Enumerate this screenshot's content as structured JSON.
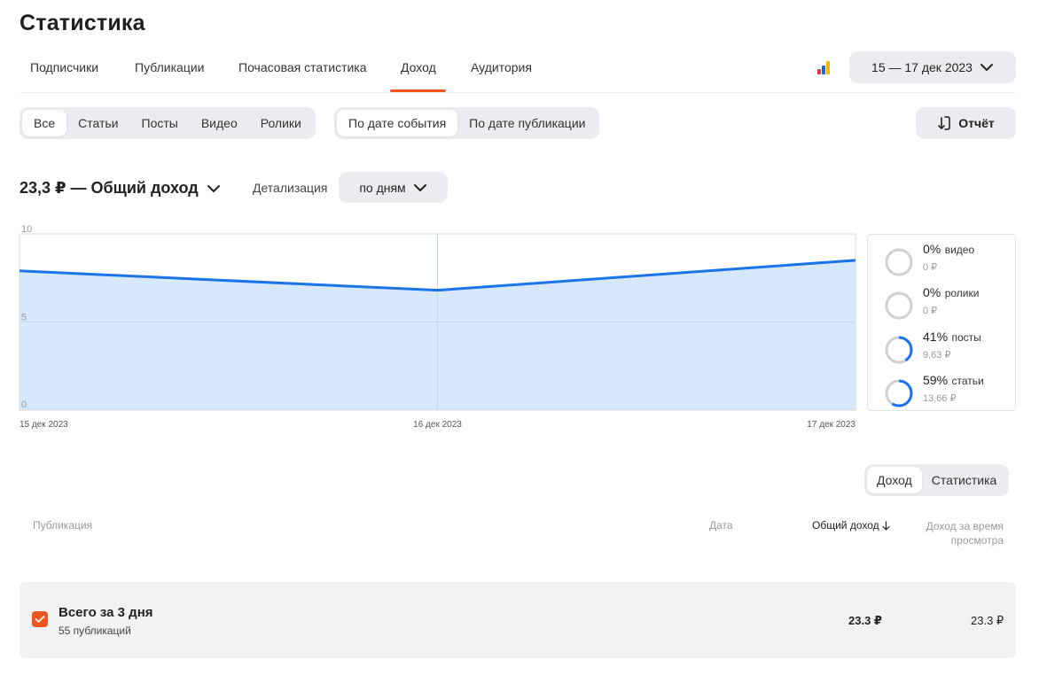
{
  "page_title": "Статистика",
  "nav_tabs": [
    {
      "label": "Подписчики",
      "active": false
    },
    {
      "label": "Публикации",
      "active": false
    },
    {
      "label": "Почасовая статистика",
      "active": false
    },
    {
      "label": "Доход",
      "active": true
    },
    {
      "label": "Аудитория",
      "active": false
    }
  ],
  "date_range": "15 — 17 дек 2023",
  "content_filter": [
    "Все",
    "Статьи",
    "Посты",
    "Видео",
    "Ролики"
  ],
  "content_filter_active": "Все",
  "date_mode": [
    "По дате события",
    "По дате публикации"
  ],
  "date_mode_active": "По дате события",
  "report_label": "Отчёт",
  "summary": {
    "total_label": "23,3 ₽ — Общий доход",
    "detail_label": "Детализация",
    "detail_value": "по дням"
  },
  "chart_data": {
    "type": "area",
    "x": [
      "15 дек 2023",
      "16 дек 2023",
      "17 дек 2023"
    ],
    "series": [
      {
        "values": [
          7.9,
          6.8,
          8.5
        ]
      }
    ],
    "ylim": [
      0,
      10
    ],
    "yticks": [
      "10",
      "5",
      "0"
    ],
    "grid": true,
    "colors": {
      "line": "#1a73e8",
      "fill": "#d6e8fc"
    }
  },
  "breakdown": [
    {
      "pct": "0%",
      "label": "видео",
      "sum": "0 ₽",
      "fraction": 0
    },
    {
      "pct": "0%",
      "label": "ролики",
      "sum": "0 ₽",
      "fraction": 0
    },
    {
      "pct": "41%",
      "label": "посты",
      "sum": "9,63 ₽",
      "fraction": 0.41
    },
    {
      "pct": "59%",
      "label": "статьи",
      "sum": "13,66 ₽",
      "fraction": 0.59
    }
  ],
  "table_view": [
    "Доход",
    "Статистика"
  ],
  "table_view_active": "Доход",
  "table": {
    "col_publication": "Публикация",
    "col_date": "Дата",
    "col_total_income": "Общий доход",
    "col_view_income_1": "Доход за время",
    "col_view_income_2": "просмотра",
    "total_row": {
      "title": "Всего за 3 дня",
      "subtitle": "55 публикаций",
      "total_income": "23.3 ₽",
      "view_income": "23.3 ₽",
      "checked": true
    }
  },
  "colors": {
    "accent": "#f0541e",
    "line": "#1a73e8",
    "ring": "#d0d0d0"
  }
}
